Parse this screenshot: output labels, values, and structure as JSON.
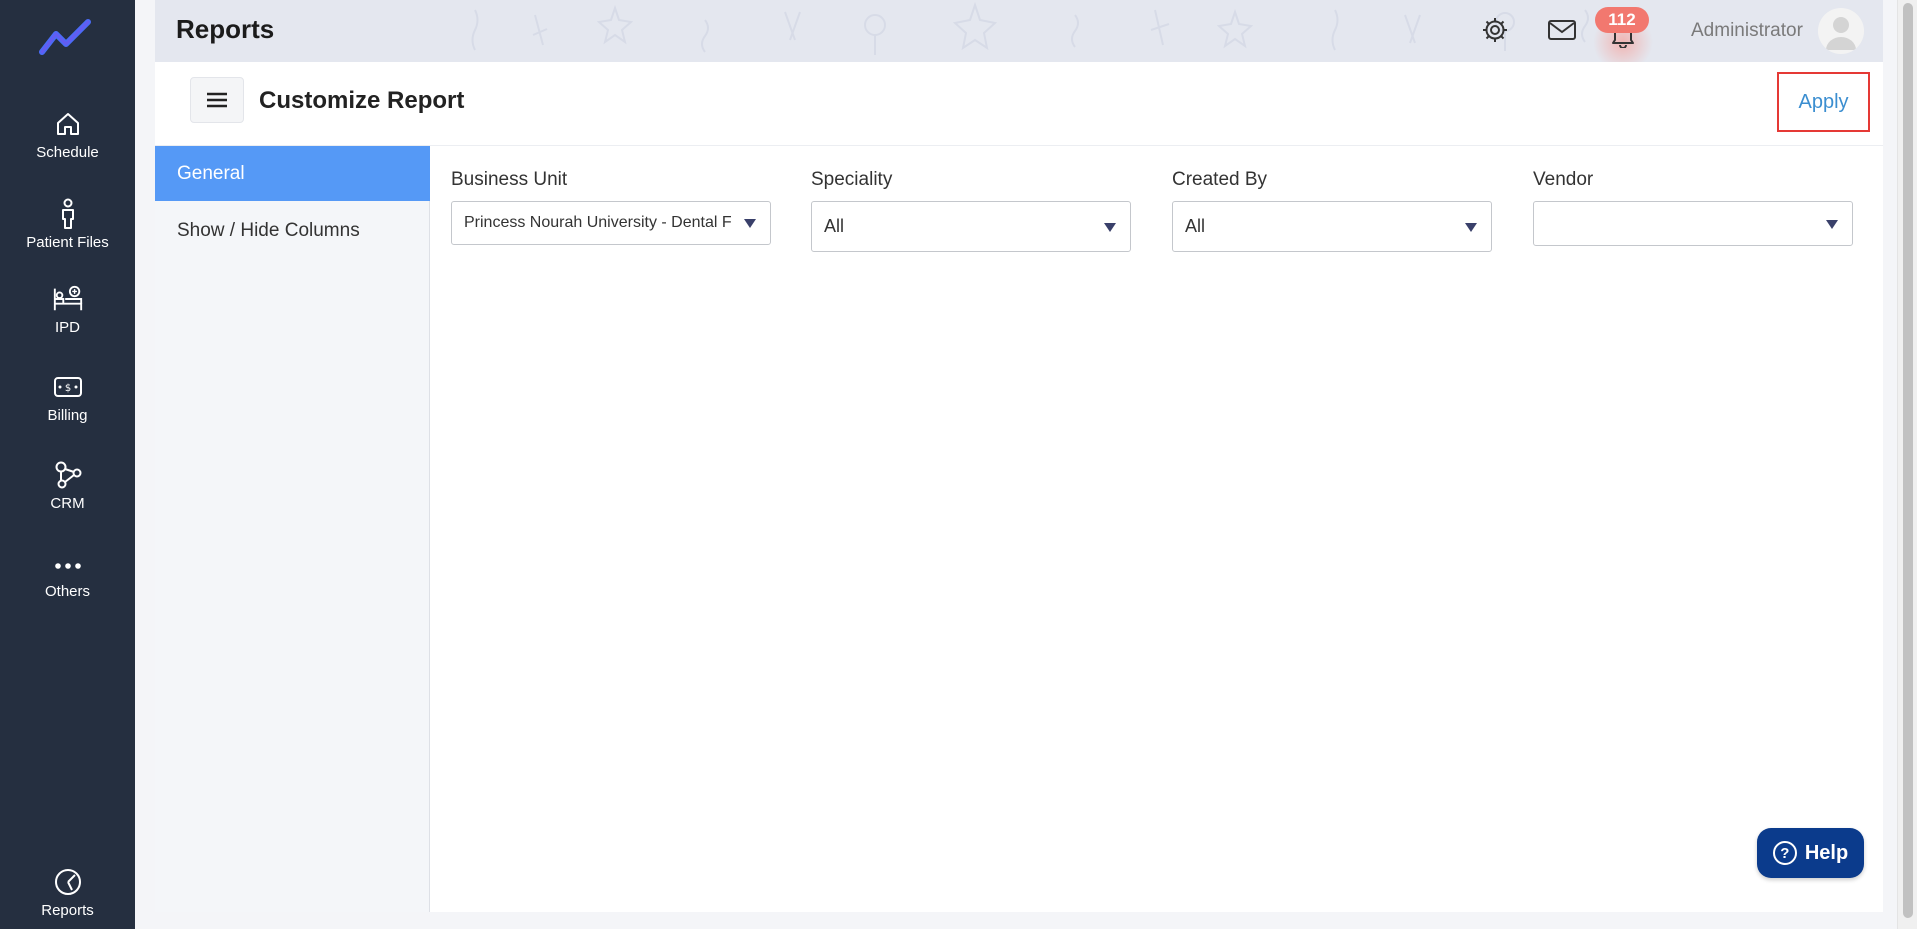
{
  "sidebar": {
    "logo_icon": "trend-line-icon",
    "items": [
      {
        "label": "Schedule",
        "icon": "home-icon"
      },
      {
        "label": "Patient Files",
        "icon": "person-icon"
      },
      {
        "label": "IPD",
        "icon": "hospital-bed-icon"
      },
      {
        "label": "Billing",
        "icon": "cash-icon"
      },
      {
        "label": "CRM",
        "icon": "network-icon"
      },
      {
        "label": "Others",
        "icon": "more-dots-icon"
      }
    ],
    "bottom_item": {
      "label": "Reports",
      "icon": "pie-chart-icon"
    }
  },
  "topbar": {
    "title": "Reports",
    "notification_count": "112",
    "user_name": "Administrator"
  },
  "panel": {
    "title": "Customize Report",
    "apply_label": "Apply",
    "tabs": [
      {
        "label": "General",
        "active": true
      },
      {
        "label": "Show / Hide Columns",
        "active": false
      }
    ],
    "filters": [
      {
        "label": "Business Unit",
        "value": "Princess Nourah University - Dental F"
      },
      {
        "label": "Speciality",
        "value": "All"
      },
      {
        "label": "Created By",
        "value": "All"
      },
      {
        "label": "Vendor",
        "value": ""
      }
    ]
  },
  "help": {
    "label": "Help"
  },
  "colors": {
    "sidebar_bg": "#252f40",
    "accent_blue": "#5599f6",
    "apply_text": "#3b8ed0",
    "highlight_border": "#e53935",
    "badge_bg": "#f2786f",
    "help_bg": "#0b3b8c"
  }
}
